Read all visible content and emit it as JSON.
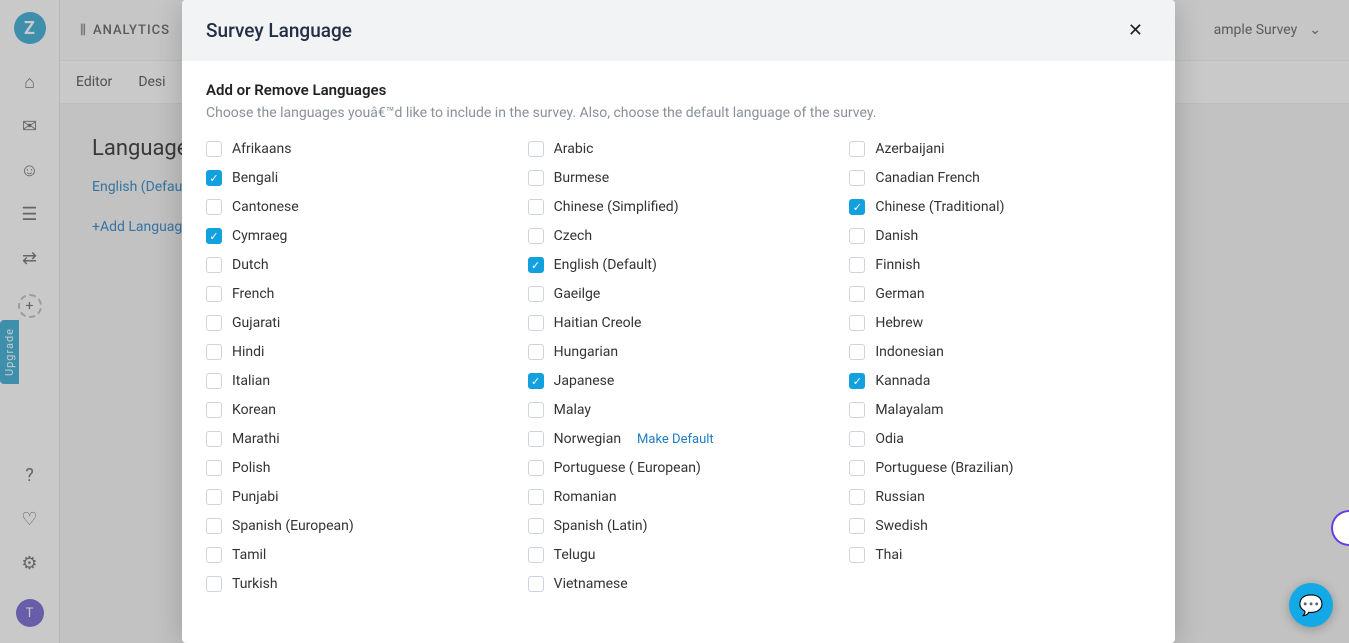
{
  "logo_letter": "Z",
  "upgrade_label": "Upgrade",
  "analytics_label": "ANALYTICS",
  "survey_dropdown": "ample Survey",
  "tabs": {
    "editor": "Editor",
    "design": "Desi"
  },
  "page": {
    "title": "Language",
    "current_lang": "English",
    "default_tag": "(Defau",
    "add_lang": "+Add Languag"
  },
  "avatar_initial": "T",
  "modal": {
    "title": "Survey Language",
    "sub_title": "Add or Remove Languages",
    "sub_desc": "Choose the languages youâ€™d like to include in the survey. Also, choose the default language of the survey.",
    "make_default": "Make Default"
  },
  "languages": [
    {
      "label": "Afrikaans",
      "checked": false
    },
    {
      "label": "Arabic",
      "checked": false
    },
    {
      "label": "Azerbaijani",
      "checked": false
    },
    {
      "label": "Bengali",
      "checked": true
    },
    {
      "label": "Burmese",
      "checked": false
    },
    {
      "label": "Canadian French",
      "checked": false
    },
    {
      "label": "Cantonese",
      "checked": false
    },
    {
      "label": "Chinese (Simplified)",
      "checked": false
    },
    {
      "label": "Chinese (Traditional)",
      "checked": true
    },
    {
      "label": "Cymraeg",
      "checked": true
    },
    {
      "label": "Czech",
      "checked": false
    },
    {
      "label": "Danish",
      "checked": false
    },
    {
      "label": "Dutch",
      "checked": false
    },
    {
      "label": "English (Default)",
      "checked": true
    },
    {
      "label": "Finnish",
      "checked": false
    },
    {
      "label": "French",
      "checked": false
    },
    {
      "label": "Gaeilge",
      "checked": false
    },
    {
      "label": "German",
      "checked": false
    },
    {
      "label": "Gujarati",
      "checked": false
    },
    {
      "label": "Haitian Creole",
      "checked": false
    },
    {
      "label": "Hebrew",
      "checked": false
    },
    {
      "label": "Hindi",
      "checked": false
    },
    {
      "label": "Hungarian",
      "checked": false
    },
    {
      "label": "Indonesian",
      "checked": false
    },
    {
      "label": "Italian",
      "checked": false
    },
    {
      "label": "Japanese",
      "checked": true
    },
    {
      "label": "Kannada",
      "checked": true
    },
    {
      "label": "Korean",
      "checked": false
    },
    {
      "label": "Malay",
      "checked": false
    },
    {
      "label": "Malayalam",
      "checked": false
    },
    {
      "label": "Marathi",
      "checked": false
    },
    {
      "label": "Norwegian",
      "checked": false,
      "show_make_default": true
    },
    {
      "label": "Odia",
      "checked": false
    },
    {
      "label": "Polish",
      "checked": false
    },
    {
      "label": "Portuguese ( European)",
      "checked": false
    },
    {
      "label": "Portuguese (Brazilian)",
      "checked": false
    },
    {
      "label": "Punjabi",
      "checked": false
    },
    {
      "label": "Romanian",
      "checked": false
    },
    {
      "label": "Russian",
      "checked": false
    },
    {
      "label": "Spanish (European)",
      "checked": false
    },
    {
      "label": "Spanish (Latin)",
      "checked": false
    },
    {
      "label": "Swedish",
      "checked": false
    },
    {
      "label": "Tamil",
      "checked": false
    },
    {
      "label": "Telugu",
      "checked": false
    },
    {
      "label": "Thai",
      "checked": false
    },
    {
      "label": "Turkish",
      "checked": false
    },
    {
      "label": "Vietnamese",
      "checked": false
    }
  ]
}
